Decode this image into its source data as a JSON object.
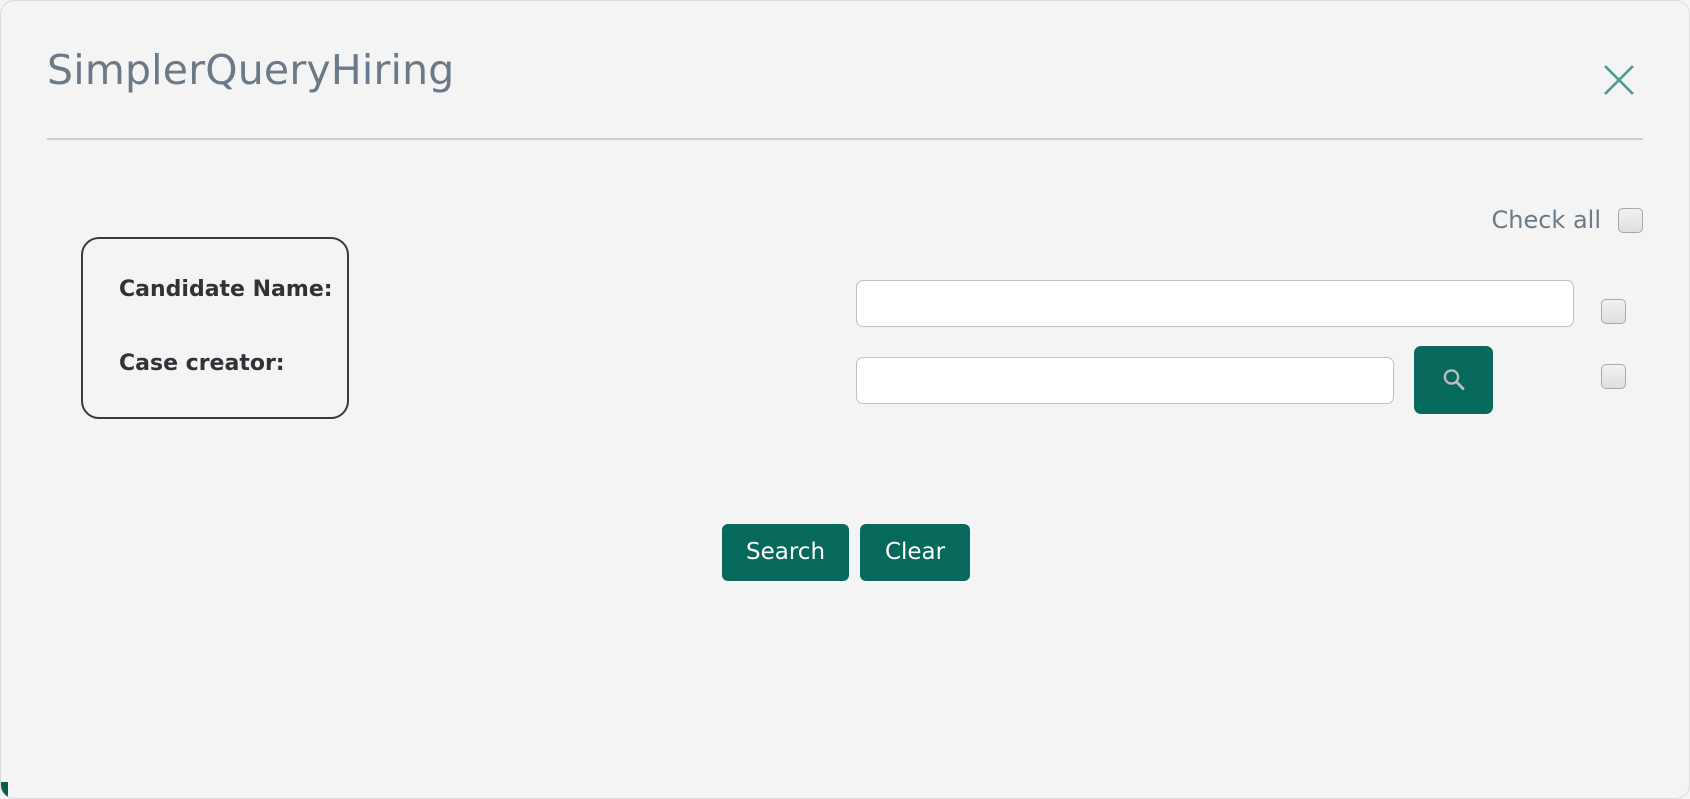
{
  "dialog": {
    "title": "SimplerQueryHiring",
    "close_icon": "close-x-icon",
    "accent_color": "#07695b",
    "title_color": "#6b7a88",
    "background_color": "#f4f4f4"
  },
  "check_all": {
    "label": "Check all",
    "checked": false
  },
  "fields": [
    {
      "label": "Candidate Name:",
      "value": "",
      "placeholder": "",
      "checkbox_checked": false,
      "has_lookup_button": false
    },
    {
      "label": "Case creator:",
      "value": "",
      "placeholder": "",
      "checkbox_checked": false,
      "has_lookup_button": true,
      "lookup_icon": "magnifier-icon"
    }
  ],
  "actions": {
    "search_label": "Search",
    "clear_label": "Clear"
  }
}
